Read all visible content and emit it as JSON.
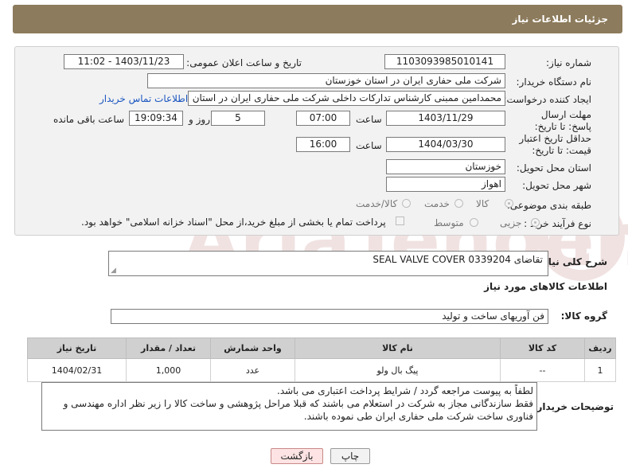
{
  "header": {
    "title": "جزئیات اطلاعات نیاز"
  },
  "form": {
    "need_number": {
      "label": "شماره نیاز:",
      "value": "1103093985010141"
    },
    "announce_datetime": {
      "label": "تاریخ و ساعت اعلان عمومی:",
      "value": "1403/11/23 - 11:02"
    },
    "buyer_org": {
      "label": "نام دستگاه خریدار:",
      "value": "شرکت ملی حفاری ایران در استان خوزستان"
    },
    "requester": {
      "label": "ایجاد کننده درخواست:",
      "value": "محمدامین ممبنی کارشناس تدارکات داخلی شرکت ملی حفاری ایران در استان خوزستان",
      "contact_link": "اطلاعات تماس خریدار"
    },
    "deadline": {
      "label": "مهلت ارسال پاسخ: تا تاریخ:",
      "date": "1403/11/29",
      "time_label": "ساعت",
      "time": "07:00",
      "days": "5",
      "days_label": "روز و",
      "remaining": "19:09:34",
      "remaining_label": "ساعت باقی مانده"
    },
    "price_validity": {
      "label": "حداقل تاریخ اعتبار قیمت: تا تاریخ:",
      "date": "1404/03/30",
      "time_label": "ساعت",
      "time": "16:00"
    },
    "province": {
      "label": "استان محل تحویل:",
      "value": "خوزستان"
    },
    "city": {
      "label": "شهر محل تحویل:",
      "value": "اهواز"
    },
    "category": {
      "label": "طبقه بندی موضوعی:",
      "options": [
        "کالا",
        "خدمت",
        "کالا/خدمت"
      ],
      "selected": "کالا"
    },
    "process": {
      "label": "نوع فرآیند خرید :",
      "options": [
        "جزیی",
        "متوسط"
      ],
      "selected": "جزیی",
      "payment_note": "پرداخت تمام یا بخشی از مبلغ خرید،از محل \"اسناد خزانه اسلامی\" خواهد بود."
    }
  },
  "description": {
    "label": "شرح کلی نیاز:",
    "value": "تقاضای SEAL VALVE COVER 0339204"
  },
  "goods_section": {
    "title": "اطلاعات کالاهای مورد نیاز"
  },
  "goods_group": {
    "label": "گروه کالا:",
    "value": "فن آوریهای ساخت و تولید"
  },
  "items_table": {
    "headers": [
      "ردیف",
      "کد کالا",
      "نام کالا",
      "واحد شمارش",
      "تعداد / مقدار",
      "تاریخ نیاز"
    ],
    "rows": [
      {
        "row": "1",
        "code": "--",
        "name": "پیگ بال ولو",
        "unit": "عدد",
        "qty": "1,000",
        "date": "1404/02/31"
      }
    ]
  },
  "buyer_notes": {
    "label": "توضیحات خریدار:",
    "lines": [
      "لطفاً به پیوست مراجعه گردد / شرایط پرداخت اعتباری می باشد.",
      "فقط سازندگانی مجاز به شرکت در استعلام می باشند که قبلا مراحل پژوهشی و ساخت کالا را زیر نظر اداره مهندسی و",
      "فناوری ساخت شرکت ملی حفاری ایران طی نموده باشند."
    ]
  },
  "buttons": {
    "print": "چاپ",
    "back": "بازگشت"
  },
  "watermark": {
    "text": "AriaTender.neT"
  }
}
